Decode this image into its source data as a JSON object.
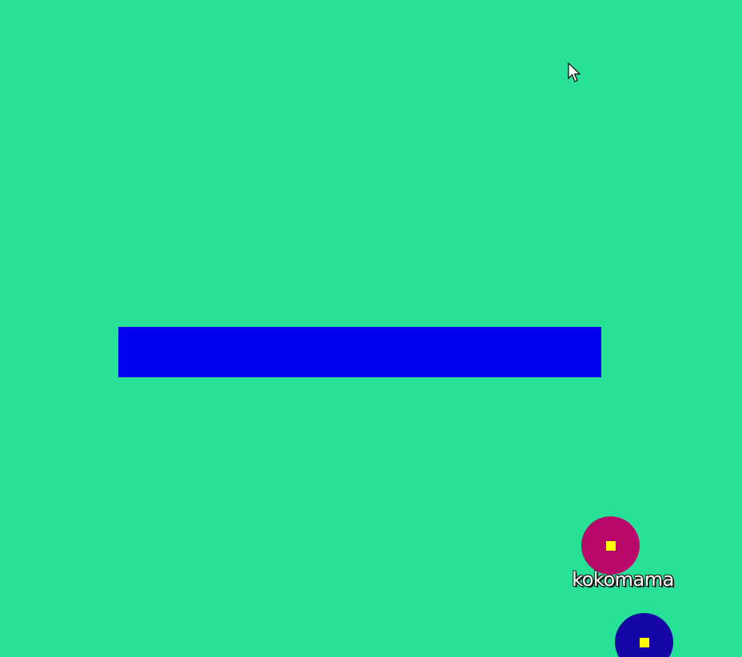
{
  "game": {
    "background_color": "#27e197",
    "platform_color": "#0000f0",
    "players": [
      {
        "name": "kokomama",
        "color": "#b8096b",
        "core_color": "#ffff00"
      },
      {
        "name": "",
        "color": "#1606a6",
        "core_color": "#ffff00"
      }
    ],
    "cursor_icon": "arrow-cursor-icon"
  }
}
